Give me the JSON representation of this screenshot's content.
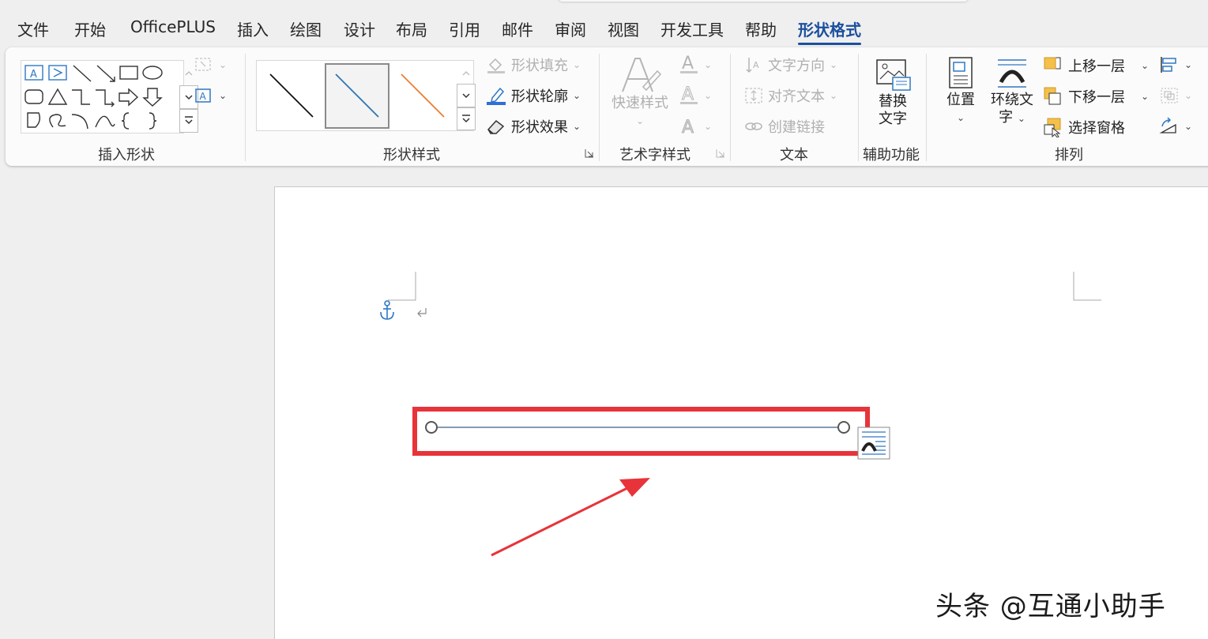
{
  "tabs": [
    {
      "label": "文件"
    },
    {
      "label": "开始"
    },
    {
      "label": "OfficePLUS"
    },
    {
      "label": "插入"
    },
    {
      "label": "绘图"
    },
    {
      "label": "设计"
    },
    {
      "label": "布局"
    },
    {
      "label": "引用"
    },
    {
      "label": "邮件"
    },
    {
      "label": "审阅"
    },
    {
      "label": "视图"
    },
    {
      "label": "开发工具"
    },
    {
      "label": "帮助"
    },
    {
      "label": "形状格式",
      "active": true
    }
  ],
  "ribbon": {
    "groups": {
      "insert_shapes": "插入形状",
      "shape_styles": "形状样式",
      "wordart_styles": "艺术字样式",
      "text": "文本",
      "accessibility": "辅助功能",
      "arrange": "排列"
    },
    "shape_fill": "形状填充",
    "shape_outline": "形状轮廓",
    "shape_effects": "形状效果",
    "quick_styles": "快速样式",
    "text_direction": "文字方向",
    "align_text": "对齐文本",
    "create_link": "创建链接",
    "alt_text_line1": "替换",
    "alt_text_line2": "文字",
    "position": "位置",
    "wrap_text_line1": "环绕文",
    "wrap_text_line2": "字",
    "bring_forward": "上移一层",
    "send_backward": "下移一层",
    "selection_pane": "选择窗格",
    "outline_color": "#2f6fd6"
  },
  "style_gallery": [
    {
      "color": "#111111"
    },
    {
      "color": "#2e75b6"
    },
    {
      "color": "#ed7d31"
    }
  ],
  "document": {
    "selected_line_color": "#3a5f85",
    "highlight_color": "#e8333a",
    "arrow_color": "#e8333a"
  },
  "watermark": "头条 @互通小助手"
}
